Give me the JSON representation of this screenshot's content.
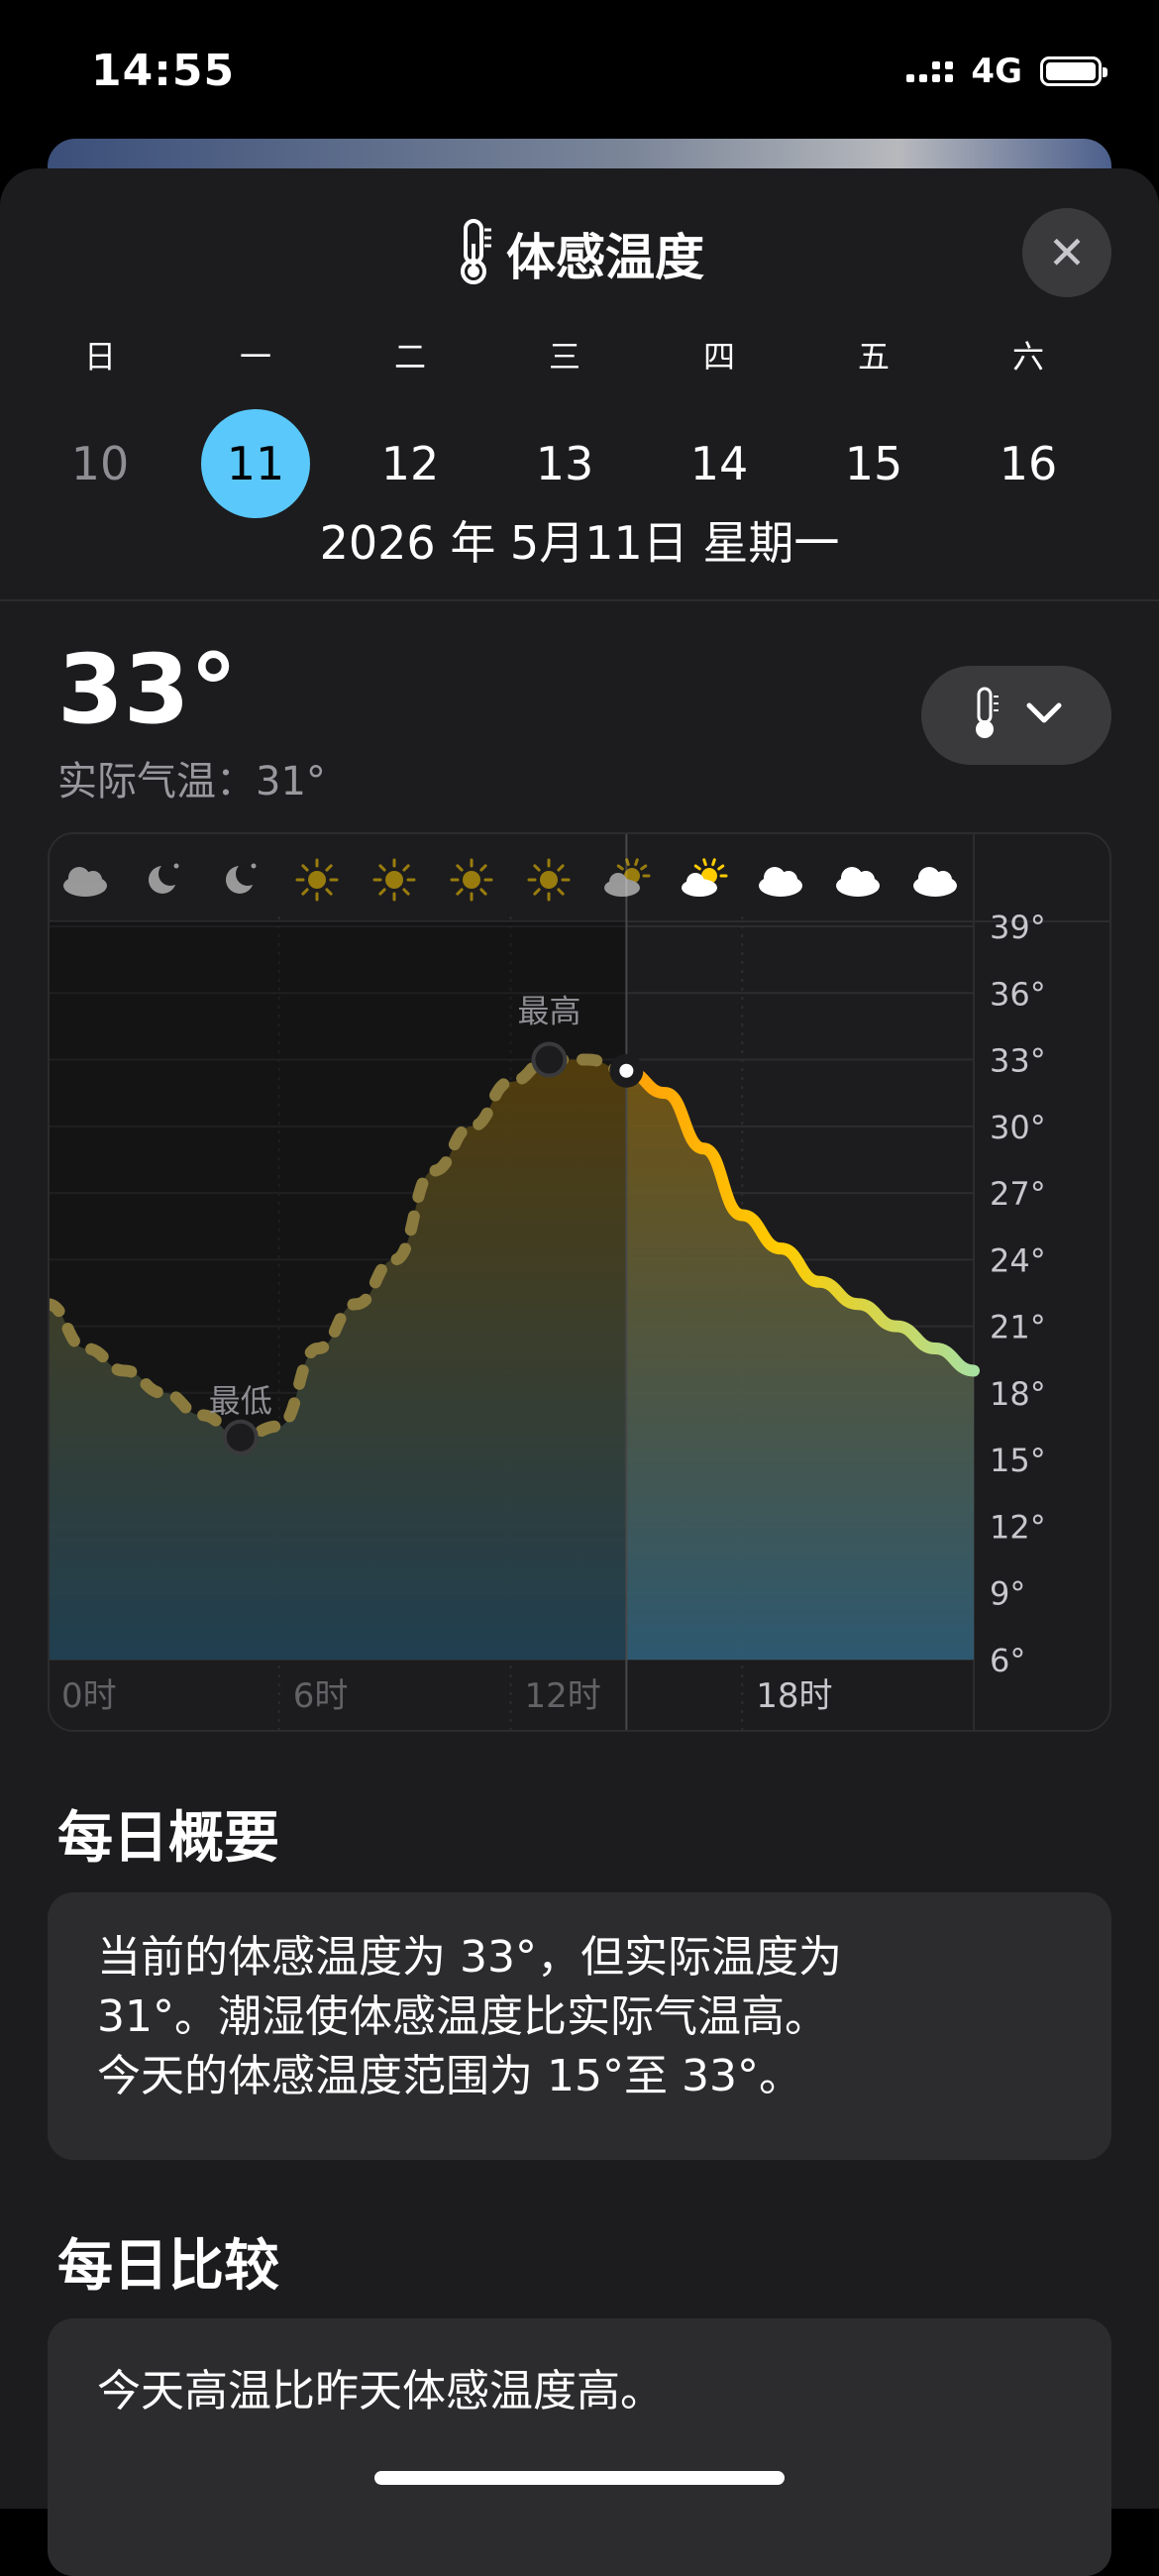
{
  "status_bar": {
    "time": "14:55",
    "network": "4G",
    "battery_level": 1.0
  },
  "header": {
    "title": "体感温度",
    "icon": "thermometer-icon",
    "close_icon": "close-icon"
  },
  "week": {
    "labels": [
      "日",
      "一",
      "二",
      "三",
      "四",
      "五",
      "六"
    ],
    "days": [
      "10",
      "11",
      "12",
      "13",
      "14",
      "15",
      "16"
    ],
    "selected_index": 1,
    "date_text": "2026 年 5月11日 星期一"
  },
  "current": {
    "feels_like": "33°",
    "actual": "实际气温：31°",
    "unit_picker_icon": "thermometer-icon"
  },
  "chart_data": {
    "type": "area",
    "x": [
      0,
      1,
      2,
      3,
      4,
      5,
      6,
      7,
      8,
      9,
      10,
      11,
      12,
      13,
      14,
      15,
      16,
      17,
      18,
      19,
      20,
      21,
      22,
      23,
      24
    ],
    "values": [
      22,
      20,
      19,
      18,
      17,
      16,
      16.5,
      20,
      22,
      24,
      28,
      30,
      32,
      33,
      33,
      32.5,
      31.5,
      29,
      26,
      24.5,
      23,
      22,
      21,
      20,
      19
    ],
    "x_ticks": [
      "0时",
      "6时",
      "12时",
      "18时"
    ],
    "y_ticks": [
      "39°",
      "36°",
      "33°",
      "30°",
      "27°",
      "24°",
      "21°",
      "18°",
      "15°",
      "12°",
      "9°",
      "6°"
    ],
    "ylim": [
      6,
      39
    ],
    "now_hour": 15,
    "min_label": "最低",
    "max_label": "最高",
    "hourly_icons": [
      "cloud-icon",
      "moon-icon",
      "moon-icon",
      "sun-icon",
      "sun-icon",
      "sun-icon",
      "sun-icon",
      "partly-cloudy-icon",
      "partly-cloudy-icon",
      "cloud-icon",
      "cloud-icon",
      "cloud-icon"
    ],
    "colors": {
      "past_line": "#8a7a3e",
      "now_line": "#ff9f0a",
      "warm": "#ffcc00",
      "cool": "#a8e0a0",
      "fill_top": "#7a5a10",
      "fill_bottom": "#2f5f79"
    }
  },
  "summary": {
    "title": "每日概要",
    "lines": [
      "当前的体感温度为 33°，但实际温度为",
      "31°。潮湿使体感温度比实际气温高。",
      "今天的体感温度范围为 15°至 33°。"
    ]
  },
  "comparison": {
    "title": "每日比较",
    "text": "今天高温比昨天体感温度高。"
  }
}
